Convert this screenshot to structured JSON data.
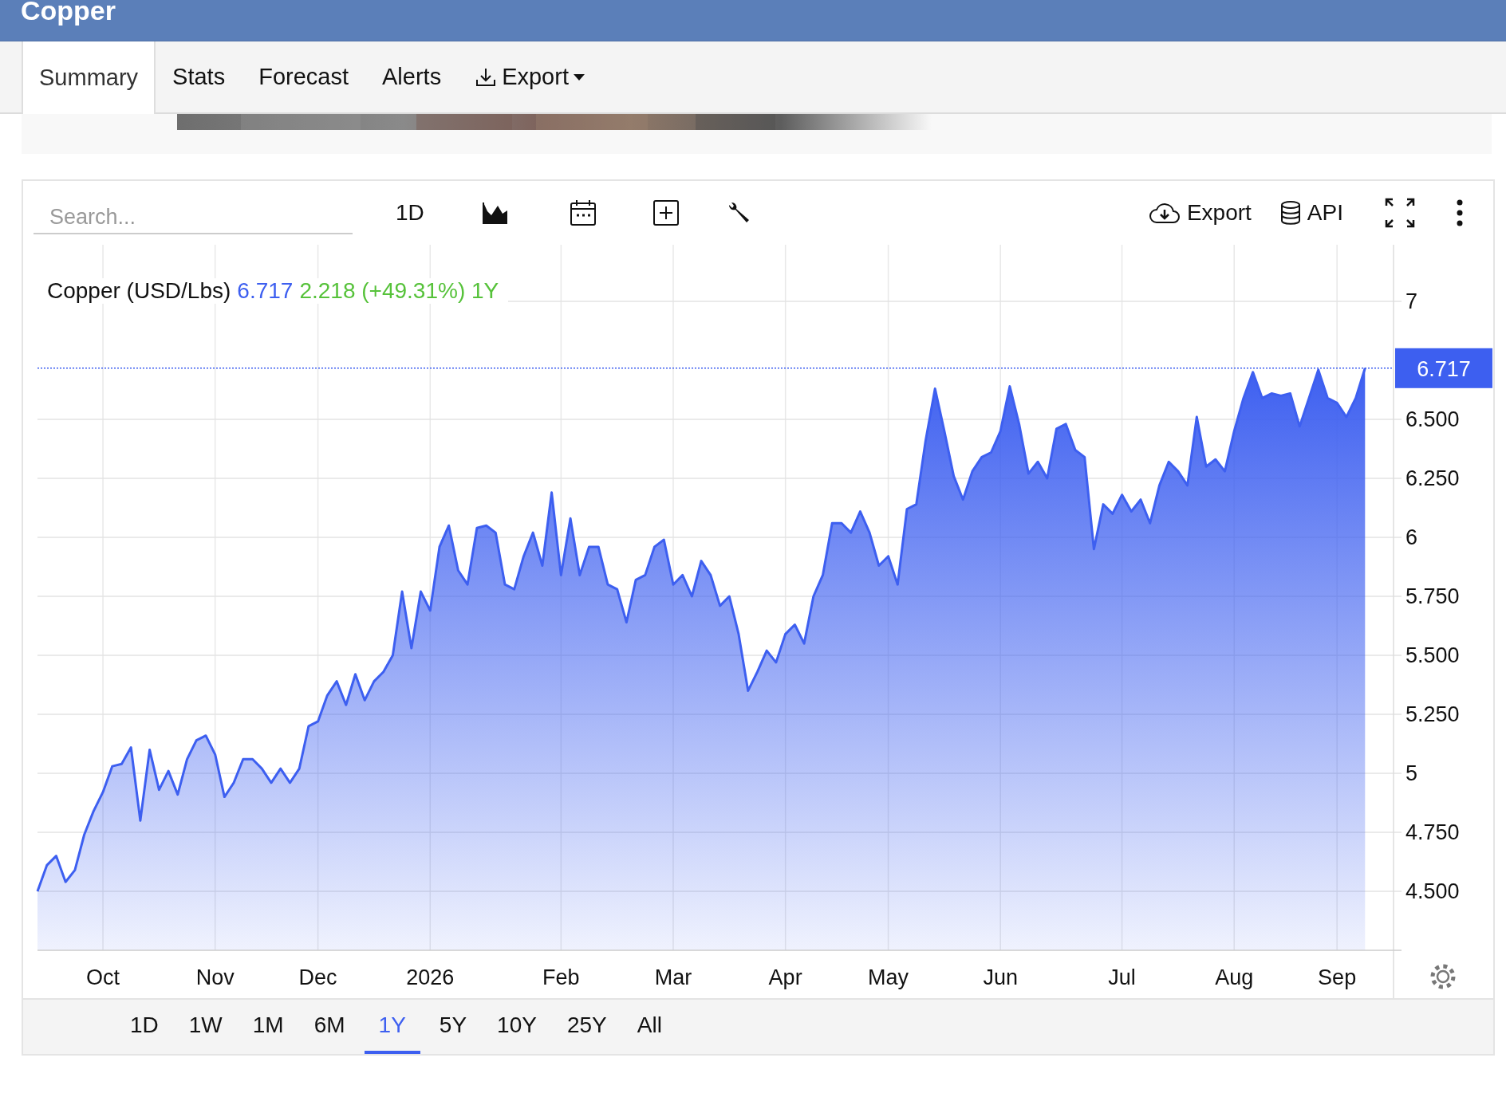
{
  "header": {
    "title": "Copper"
  },
  "tabs": [
    {
      "label": "Summary",
      "selected": true,
      "kind": "tab"
    },
    {
      "label": "Stats",
      "selected": false,
      "kind": "tab"
    },
    {
      "label": "Forecast",
      "selected": false,
      "kind": "tab"
    },
    {
      "label": "Alerts",
      "selected": false,
      "kind": "tab"
    },
    {
      "label": "Export",
      "selected": false,
      "kind": "dropdown"
    }
  ],
  "toolbar": {
    "search": {
      "placeholder": "Search..."
    },
    "interval": "1D",
    "export": "Export",
    "api": "API"
  },
  "chart": {
    "legend": {
      "price": "6.717",
      "change": "2.218 (+49.31%) 1Y"
    },
    "last_price_label": "6.717",
    "chart_data": {
      "type": "area",
      "categories": [
        null,
        null,
        null,
        null,
        null,
        null,
        null,
        "Oct",
        null,
        null,
        null,
        null,
        null,
        null,
        null,
        null,
        null,
        null,
        null,
        "Nov",
        null,
        null,
        null,
        null,
        null,
        null,
        null,
        null,
        null,
        null,
        "Dec",
        null,
        null,
        null,
        null,
        null,
        null,
        null,
        null,
        null,
        null,
        null,
        "2026",
        null,
        null,
        null,
        null,
        null,
        null,
        null,
        null,
        null,
        null,
        null,
        null,
        null,
        "Feb",
        null,
        null,
        null,
        null,
        null,
        null,
        null,
        null,
        null,
        null,
        null,
        "Mar",
        null,
        null,
        null,
        null,
        null,
        null,
        null,
        null,
        null,
        null,
        null,
        "Apr",
        null,
        null,
        null,
        null,
        null,
        null,
        null,
        null,
        null,
        null,
        "May",
        null,
        null,
        null,
        null,
        null,
        null,
        null,
        null,
        null,
        null,
        null,
        "Jun",
        null,
        null,
        null,
        null,
        null,
        null,
        null,
        null,
        null,
        null,
        null,
        null,
        "Jul",
        null,
        null,
        null,
        null,
        null,
        null,
        null,
        null,
        null,
        null,
        null,
        "Aug",
        null,
        null,
        null,
        null,
        null,
        null,
        null,
        null,
        null,
        null,
        "Sep",
        null,
        null,
        null
      ],
      "series": [
        {
          "name": "Copper (USD/Lbs)",
          "color": "#3d5ff0",
          "values": [
            4.5,
            4.61,
            4.65,
            4.54,
            4.59,
            4.74,
            4.84,
            4.92,
            5.03,
            5.04,
            5.11,
            4.8,
            5.1,
            4.93,
            5.01,
            4.91,
            5.06,
            5.14,
            5.16,
            5.08,
            4.9,
            4.96,
            5.06,
            5.06,
            5.02,
            4.96,
            5.02,
            4.96,
            5.02,
            5.2,
            5.22,
            5.33,
            5.39,
            5.29,
            5.42,
            5.31,
            5.39,
            5.43,
            5.5,
            5.77,
            5.53,
            5.77,
            5.69,
            5.96,
            6.05,
            5.86,
            5.8,
            6.04,
            6.05,
            6.02,
            5.8,
            5.78,
            5.92,
            6.02,
            5.88,
            6.19,
            5.84,
            6.08,
            5.84,
            5.96,
            5.96,
            5.8,
            5.78,
            5.64,
            5.82,
            5.84,
            5.96,
            5.99,
            5.8,
            5.84,
            5.75,
            5.9,
            5.84,
            5.71,
            5.75,
            5.59,
            5.35,
            5.43,
            5.52,
            5.47,
            5.59,
            5.63,
            5.55,
            5.75,
            5.84,
            6.06,
            6.06,
            6.02,
            6.11,
            6.02,
            5.88,
            5.92,
            5.8,
            6.12,
            6.14,
            6.41,
            6.63,
            6.45,
            6.26,
            6.16,
            6.28,
            6.34,
            6.36,
            6.45,
            6.64,
            6.48,
            6.27,
            6.32,
            6.25,
            6.46,
            6.48,
            6.37,
            6.34,
            5.95,
            6.14,
            6.1,
            6.18,
            6.11,
            6.16,
            6.06,
            6.22,
            6.32,
            6.28,
            6.22,
            6.51,
            6.3,
            6.33,
            6.28,
            6.45,
            6.59,
            6.7,
            6.59,
            6.61,
            6.6,
            6.61,
            6.47,
            6.59,
            6.71,
            6.59,
            6.57,
            6.51,
            6.59,
            6.717
          ]
        }
      ],
      "ylim": [
        4.25,
        7.24
      ],
      "grid": true,
      "ref_lines": [
        {
          "axis": "y",
          "value": 6.717,
          "color": "#3d5ff0"
        }
      ],
      "yticks": [
        {
          "value": 7,
          "label": "7"
        },
        {
          "value": 6.5,
          "label": "6.500"
        },
        {
          "value": 6.25,
          "label": "6.250"
        },
        {
          "value": 6,
          "label": "6"
        },
        {
          "value": 5.75,
          "label": "5.750"
        },
        {
          "value": 5.5,
          "label": "5.500"
        },
        {
          "value": 5.25,
          "label": "5.250"
        },
        {
          "value": 5,
          "label": "5"
        },
        {
          "value": 4.75,
          "label": "4.750"
        },
        {
          "value": 4.5,
          "label": "4.500"
        }
      ]
    }
  },
  "ranges": [
    {
      "label": "1D",
      "selected": false
    },
    {
      "label": "1W",
      "selected": false
    },
    {
      "label": "1M",
      "selected": false
    },
    {
      "label": "6M",
      "selected": false
    },
    {
      "label": "1Y",
      "selected": true
    },
    {
      "label": "5Y",
      "selected": false
    },
    {
      "label": "10Y",
      "selected": false
    },
    {
      "label": "25Y",
      "selected": false
    },
    {
      "label": "All",
      "selected": false
    }
  ]
}
